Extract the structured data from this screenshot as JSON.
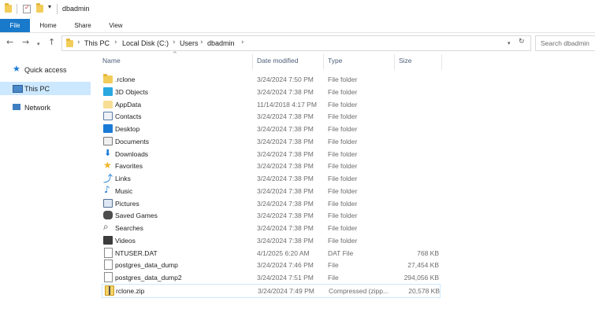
{
  "window": {
    "title": "dbadmin"
  },
  "ribbon": {
    "tabs": [
      "File",
      "Home",
      "Share",
      "View"
    ]
  },
  "address": {
    "crumbs": [
      "This PC",
      "Local Disk (C:)",
      "Users",
      "dbadmin"
    ],
    "search_placeholder": "Search dbadmin"
  },
  "nav": {
    "items": [
      {
        "label": "Quick access",
        "icon": "star-icon"
      },
      {
        "label": "This PC",
        "icon": "computer-icon",
        "selected": true
      },
      {
        "label": "Network",
        "icon": "network-icon"
      }
    ]
  },
  "columns": {
    "name": "Name",
    "date": "Date modified",
    "type": "Type",
    "size": "Size"
  },
  "files": [
    {
      "name": ".rclone",
      "date": "3/24/2024 7:50 PM",
      "type": "File folder",
      "size": "",
      "icon": "folder-icon"
    },
    {
      "name": "3D Objects",
      "date": "3/24/2024 7:38 PM",
      "type": "File folder",
      "size": "",
      "icon": "3d-objects-icon"
    },
    {
      "name": "AppData",
      "date": "11/14/2018 4:17 PM",
      "type": "File folder",
      "size": "",
      "icon": "hidden-folder-icon"
    },
    {
      "name": "Contacts",
      "date": "3/24/2024 7:38 PM",
      "type": "File folder",
      "size": "",
      "icon": "contacts-icon"
    },
    {
      "name": "Desktop",
      "date": "3/24/2024 7:38 PM",
      "type": "File folder",
      "size": "",
      "icon": "desktop-icon"
    },
    {
      "name": "Documents",
      "date": "3/24/2024 7:38 PM",
      "type": "File folder",
      "size": "",
      "icon": "documents-icon"
    },
    {
      "name": "Downloads",
      "date": "3/24/2024 7:38 PM",
      "type": "File folder",
      "size": "",
      "icon": "downloads-icon"
    },
    {
      "name": "Favorites",
      "date": "3/24/2024 7:38 PM",
      "type": "File folder",
      "size": "",
      "icon": "favorites-icon"
    },
    {
      "name": "Links",
      "date": "3/24/2024 7:38 PM",
      "type": "File folder",
      "size": "",
      "icon": "links-icon"
    },
    {
      "name": "Music",
      "date": "3/24/2024 7:38 PM",
      "type": "File folder",
      "size": "",
      "icon": "music-icon"
    },
    {
      "name": "Pictures",
      "date": "3/24/2024 7:38 PM",
      "type": "File folder",
      "size": "",
      "icon": "pictures-icon"
    },
    {
      "name": "Saved Games",
      "date": "3/24/2024 7:38 PM",
      "type": "File folder",
      "size": "",
      "icon": "saved-games-icon"
    },
    {
      "name": "Searches",
      "date": "3/24/2024 7:38 PM",
      "type": "File folder",
      "size": "",
      "icon": "searches-icon"
    },
    {
      "name": "Videos",
      "date": "3/24/2024 7:38 PM",
      "type": "File folder",
      "size": "",
      "icon": "videos-icon"
    },
    {
      "name": "NTUSER.DAT",
      "date": "4/1/2025 6:20 AM",
      "type": "DAT File",
      "size": "768 KB",
      "icon": "file-icon"
    },
    {
      "name": "postgres_data_dump",
      "date": "3/24/2024 7:46 PM",
      "type": "File",
      "size": "27,454 KB",
      "icon": "file-icon"
    },
    {
      "name": "postgres_data_dump2",
      "date": "3/24/2024 7:51 PM",
      "type": "File",
      "size": "294,056 KB",
      "icon": "file-icon"
    },
    {
      "name": "rclone.zip",
      "date": "3/24/2024 7:49 PM",
      "type": "Compressed (zipp...",
      "size": "20,578 KB",
      "icon": "zip-icon",
      "selected": true
    }
  ],
  "colors": {
    "file_tab": "#1979ca",
    "nav_selected": "#cce8ff",
    "selection_border": "#cce8ff"
  }
}
